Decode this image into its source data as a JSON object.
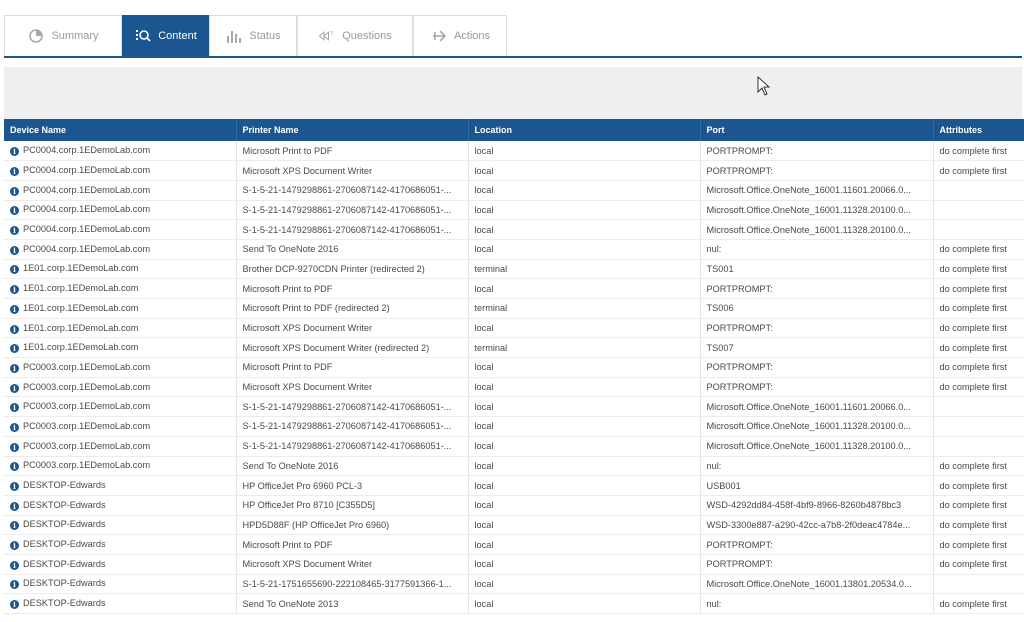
{
  "tabs": [
    {
      "label": "Summary",
      "icon": "pie-chart-icon"
    },
    {
      "label": "Content",
      "icon": "content-search-icon"
    },
    {
      "label": "Status",
      "icon": "bar-chart-icon"
    },
    {
      "label": "Questions",
      "icon": "question-arrows-icon"
    },
    {
      "label": "Actions",
      "icon": "action-arrow-icon"
    }
  ],
  "active_tab": "Content",
  "colors": {
    "accent": "#1b5690",
    "band": "#efefef"
  },
  "table": {
    "headers": [
      "Device Name",
      "Printer Name",
      "Location",
      "Port",
      "Attributes"
    ],
    "rows": [
      {
        "device": "PC0004.corp.1EDemoLab.com",
        "printer": "Microsoft Print to PDF",
        "location": "local",
        "port": "PORTPROMPT:",
        "attributes": "do complete first"
      },
      {
        "device": "PC0004.corp.1EDemoLab.com",
        "printer": "Microsoft XPS Document Writer",
        "location": "local",
        "port": "PORTPROMPT:",
        "attributes": "do complete first"
      },
      {
        "device": "PC0004.corp.1EDemoLab.com",
        "printer": "S-1-5-21-1479298861-2706087142-4170686051-...",
        "location": "local",
        "port": "Microsoft.Office.OneNote_16001.11601.20066.0...",
        "attributes": ""
      },
      {
        "device": "PC0004.corp.1EDemoLab.com",
        "printer": "S-1-5-21-1479298861-2706087142-4170686051-...",
        "location": "local",
        "port": "Microsoft.Office.OneNote_16001.11328.20100.0...",
        "attributes": ""
      },
      {
        "device": "PC0004.corp.1EDemoLab.com",
        "printer": "S-1-5-21-1479298861-2706087142-4170686051-...",
        "location": "local",
        "port": "Microsoft.Office.OneNote_16001.11328.20100.0...",
        "attributes": ""
      },
      {
        "device": "PC0004.corp.1EDemoLab.com",
        "printer": "Send To OneNote 2016",
        "location": "local",
        "port": "nul:",
        "attributes": "do complete first"
      },
      {
        "device": "1E01.corp.1EDemoLab.com",
        "printer": "Brother DCP-9270CDN Printer (redirected 2)",
        "location": "terminal",
        "port": "TS001",
        "attributes": "do complete first"
      },
      {
        "device": "1E01.corp.1EDemoLab.com",
        "printer": "Microsoft Print to PDF",
        "location": "local",
        "port": "PORTPROMPT:",
        "attributes": "do complete first"
      },
      {
        "device": "1E01.corp.1EDemoLab.com",
        "printer": "Microsoft Print to PDF (redirected 2)",
        "location": "terminal",
        "port": "TS006",
        "attributes": "do complete first"
      },
      {
        "device": "1E01.corp.1EDemoLab.com",
        "printer": "Microsoft XPS Document Writer",
        "location": "local",
        "port": "PORTPROMPT:",
        "attributes": "do complete first"
      },
      {
        "device": "1E01.corp.1EDemoLab.com",
        "printer": "Microsoft XPS Document Writer (redirected 2)",
        "location": "terminal",
        "port": "TS007",
        "attributes": "do complete first"
      },
      {
        "device": "PC0003.corp.1EDemoLab.com",
        "printer": "Microsoft Print to PDF",
        "location": "local",
        "port": "PORTPROMPT:",
        "attributes": "do complete first"
      },
      {
        "device": "PC0003.corp.1EDemoLab.com",
        "printer": "Microsoft XPS Document Writer",
        "location": "local",
        "port": "PORTPROMPT:",
        "attributes": "do complete first"
      },
      {
        "device": "PC0003.corp.1EDemoLab.com",
        "printer": "S-1-5-21-1479298861-2706087142-4170686051-...",
        "location": "local",
        "port": "Microsoft.Office.OneNote_16001.11601.20066.0...",
        "attributes": ""
      },
      {
        "device": "PC0003.corp.1EDemoLab.com",
        "printer": "S-1-5-21-1479298861-2706087142-4170686051-...",
        "location": "local",
        "port": "Microsoft.Office.OneNote_16001.11328.20100.0...",
        "attributes": ""
      },
      {
        "device": "PC0003.corp.1EDemoLab.com",
        "printer": "S-1-5-21-1479298861-2706087142-4170686051-...",
        "location": "local",
        "port": "Microsoft.Office.OneNote_16001.11328.20100.0...",
        "attributes": ""
      },
      {
        "device": "PC0003.corp.1EDemoLab.com",
        "printer": "Send To OneNote 2016",
        "location": "local",
        "port": "nul:",
        "attributes": "do complete first"
      },
      {
        "device": "DESKTOP-Edwards",
        "printer": "HP OfficeJet Pro 6960 PCL-3",
        "location": "local",
        "port": "USB001",
        "attributes": "do complete first"
      },
      {
        "device": "DESKTOP-Edwards",
        "printer": "HP OfficeJet Pro 8710 [C355D5]",
        "location": "local",
        "port": "WSD-4292dd84-458f-4bf9-8966-8260b4878bc3",
        "attributes": "do complete first"
      },
      {
        "device": "DESKTOP-Edwards",
        "printer": "HPD5D88F (HP OfficeJet Pro 6960)",
        "location": "local",
        "port": "WSD-3300e887-a290-42cc-a7b8-2f0deac4784e...",
        "attributes": "do complete first"
      },
      {
        "device": "DESKTOP-Edwards",
        "printer": "Microsoft Print to PDF",
        "location": "local",
        "port": "PORTPROMPT:",
        "attributes": "do complete first"
      },
      {
        "device": "DESKTOP-Edwards",
        "printer": "Microsoft XPS Document Writer",
        "location": "local",
        "port": "PORTPROMPT:",
        "attributes": "do complete first"
      },
      {
        "device": "DESKTOP-Edwards",
        "printer": "S-1-5-21-1751655690-222108465-3177591366-1...",
        "location": "local",
        "port": "Microsoft.Office.OneNote_16001.13801.20534.0...",
        "attributes": ""
      },
      {
        "device": "DESKTOP-Edwards",
        "printer": "Send To OneNote 2013",
        "location": "local",
        "port": "nul:",
        "attributes": "do complete first"
      }
    ]
  }
}
